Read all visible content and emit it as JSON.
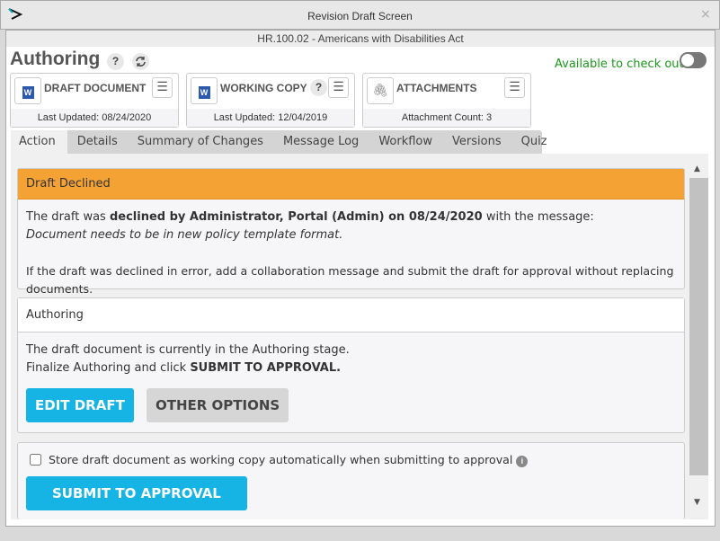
{
  "window": {
    "title": "Revision Draft Screen",
    "close": "×",
    "subtitle": "HR.100.02 - Americans with Disabilities Act"
  },
  "header": {
    "title": "Authoring",
    "help": "?",
    "availability": "Available to check out",
    "toggle_on": false
  },
  "cards": [
    {
      "label": "DRAFT DOCUMENT",
      "icon": "word-icon",
      "footer": "Last Updated: 08/24/2020"
    },
    {
      "label": "WORKING COPY",
      "icon": "word-icon",
      "help": "?",
      "footer": "Last Updated: 12/04/2019"
    },
    {
      "label": "ATTACHMENTS",
      "icon": "paperclip-icon",
      "footer": "Attachment Count: 3"
    }
  ],
  "tabs": [
    "Action",
    "Details",
    "Summary of Changes",
    "Message Log",
    "Workflow",
    "Versions",
    "Quiz"
  ],
  "declined": {
    "header": "Draft Declined",
    "color": "#f4a234",
    "text1": "The draft was ",
    "bold1": "declined by Administrator, Portal (Admin) on 08/24/2020",
    "text2": " with the message:",
    "message": "Document needs to be in new policy template format.",
    "note": "If the draft was declined in error, add a collaboration message and submit the draft for approval without replacing documents."
  },
  "authoring": {
    "header": "Authoring",
    "line1": "The draft document is currently in the Authoring stage.",
    "line2a": "Finalize Authoring and click ",
    "line2b": "SUBMIT TO APPROVAL.",
    "edit": "EDIT DRAFT",
    "other": "OTHER OPTIONS"
  },
  "submit": {
    "checkbox_label": "Store draft document as working copy automatically when submitting to approval",
    "checked": false,
    "button": "SUBMIT TO APPROVAL",
    "accent": "#16b4e4"
  }
}
